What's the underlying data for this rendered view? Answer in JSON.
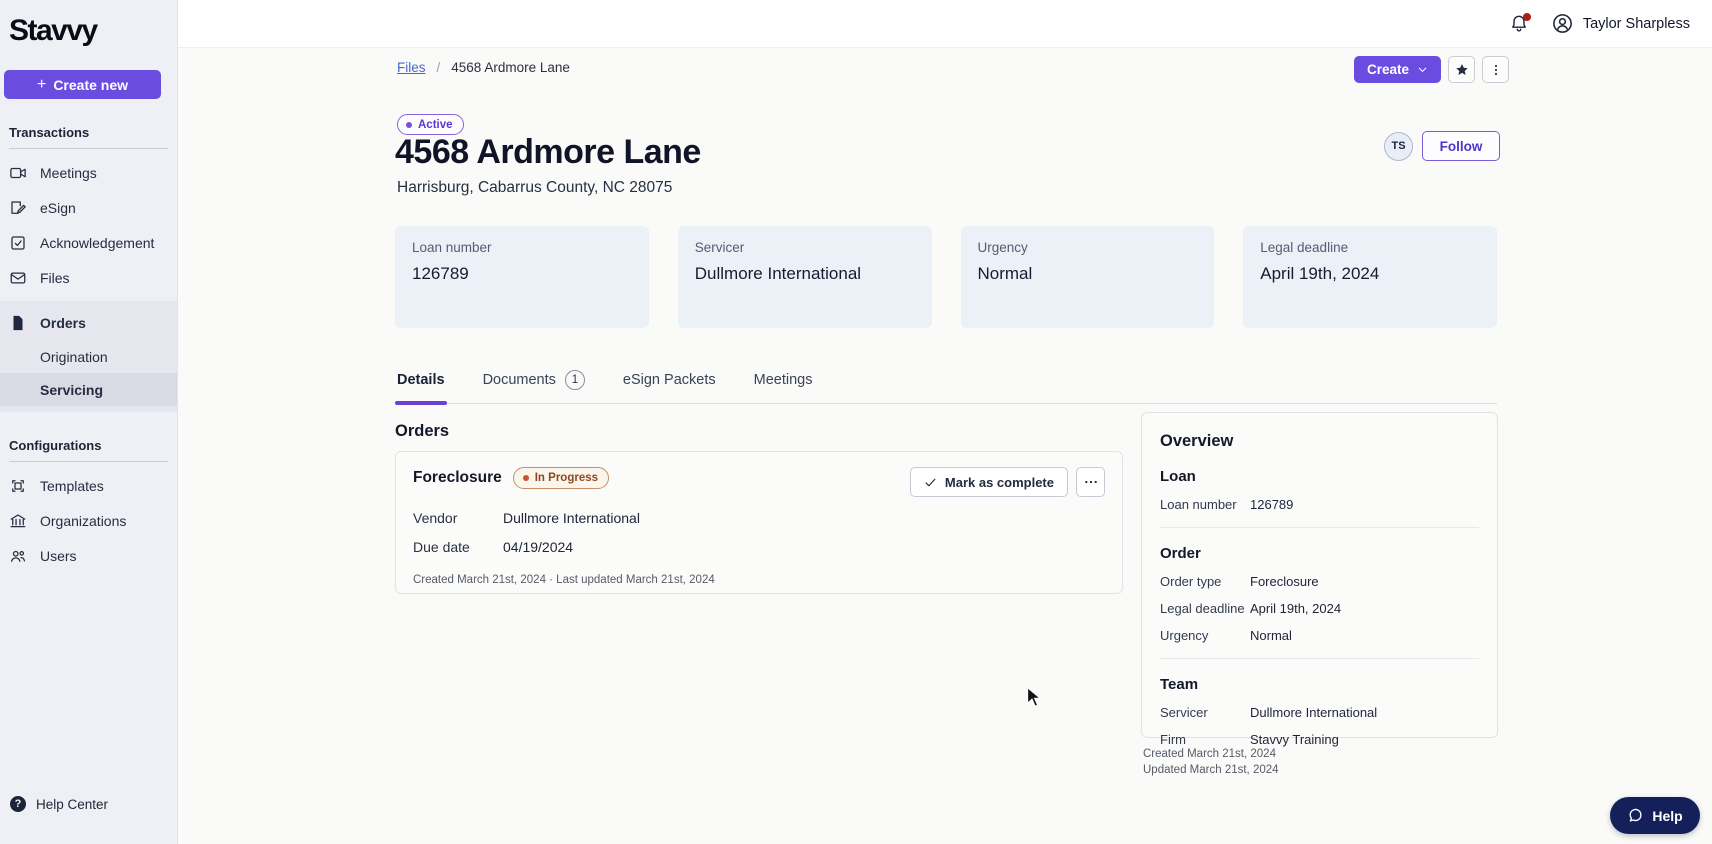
{
  "colors": {
    "primary_purple": "#6A4CE0",
    "link_blue": "#4A66D2",
    "active_badge_purple": "#5B35CE",
    "in_progress_brown": "#8A4A22",
    "in_progress_dot": "#C7552E",
    "help_navy": "#13205A",
    "notification_red": "#AE1B1B",
    "sidebar_bg": "#EFF0F6",
    "card_bg": "#ECF0F7"
  },
  "sidebar": {
    "logo": "Stavvy",
    "create_plus": "+",
    "create_button_label": "Create new",
    "transactions_header": "Transactions",
    "nav_transactions": [
      {
        "label": "Meetings"
      },
      {
        "label": "eSign"
      },
      {
        "label": "Acknowledgement"
      },
      {
        "label": "Files"
      }
    ],
    "orders_group": {
      "label": "Orders",
      "children": [
        {
          "label": "Origination"
        },
        {
          "label": "Servicing"
        }
      ]
    },
    "configurations_header": "Configurations",
    "nav_configurations": [
      {
        "label": "Templates"
      },
      {
        "label": "Organizations"
      },
      {
        "label": "Users"
      }
    ],
    "help_center_label": "Help Center"
  },
  "topbar": {
    "user_name": "Taylor Sharpless"
  },
  "breadcrumb": {
    "parent": "Files",
    "separator": "/",
    "current": "4568 Ardmore Lane"
  },
  "page_actions": {
    "create_label": "Create"
  },
  "hero": {
    "status_badge": "Active",
    "title": "4568 Ardmore Lane",
    "subtitle": "Harrisburg, Cabarrus County, NC 28075",
    "avatar_initials": "TS",
    "follow_label": "Follow"
  },
  "summary_cards": [
    {
      "label": "Loan number",
      "value": "126789"
    },
    {
      "label": "Servicer",
      "value": "Dullmore International"
    },
    {
      "label": "Urgency",
      "value": "Normal"
    },
    {
      "label": "Legal deadline",
      "value": "April 19th, 2024"
    }
  ],
  "tabs": [
    {
      "label": "Details"
    },
    {
      "label": "Documents",
      "badge": "1"
    },
    {
      "label": "eSign Packets"
    },
    {
      "label": "Meetings"
    }
  ],
  "orders_section": {
    "heading": "Orders",
    "order": {
      "title": "Foreclosure",
      "status": "In Progress",
      "mark_complete_label": "Mark as complete",
      "fields": [
        {
          "label": "Vendor",
          "value": "Dullmore International"
        },
        {
          "label": "Due date",
          "value": "04/19/2024"
        }
      ],
      "meta": "Created March 21st, 2024 · Last updated March 21st, 2024"
    }
  },
  "overview": {
    "heading": "Overview",
    "groups": [
      {
        "title": "Loan",
        "rows": [
          {
            "label": "Loan number",
            "value": "126789"
          }
        ]
      },
      {
        "title": "Order",
        "rows": [
          {
            "label": "Order type",
            "value": "Foreclosure"
          },
          {
            "label": "Legal deadline",
            "value": "April 19th, 2024"
          },
          {
            "label": "Urgency",
            "value": "Normal"
          }
        ]
      },
      {
        "title": "Team",
        "rows": [
          {
            "label": "Servicer",
            "value": "Dullmore International"
          },
          {
            "label": "Firm",
            "value": "Stavvy Training"
          }
        ]
      }
    ],
    "created": "Created March 21st, 2024",
    "updated": "Updated March 21st, 2024"
  },
  "help_fab_label": "Help"
}
